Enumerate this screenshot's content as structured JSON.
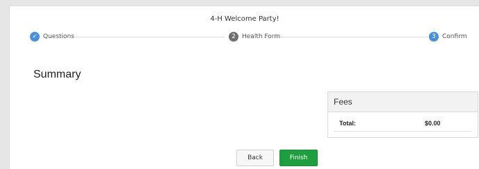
{
  "form": {
    "title": "4-H Welcome Party!"
  },
  "steps": [
    {
      "label": "Questions",
      "marker": "✓",
      "state": "complete"
    },
    {
      "label": "Health Form",
      "marker": "2",
      "state": "inactive"
    },
    {
      "label": "Confirm",
      "marker": "3",
      "state": "current"
    }
  ],
  "summary": {
    "title": "Summary"
  },
  "fees": {
    "header": "Fees",
    "total_label": "Total:",
    "total_value": "$0.00"
  },
  "actions": {
    "back_label": "Back",
    "finish_label": "Finish"
  },
  "colors": {
    "step_active": "#4a90d9",
    "step_inactive": "#6f6f6f",
    "finish": "#1e9e3f"
  }
}
